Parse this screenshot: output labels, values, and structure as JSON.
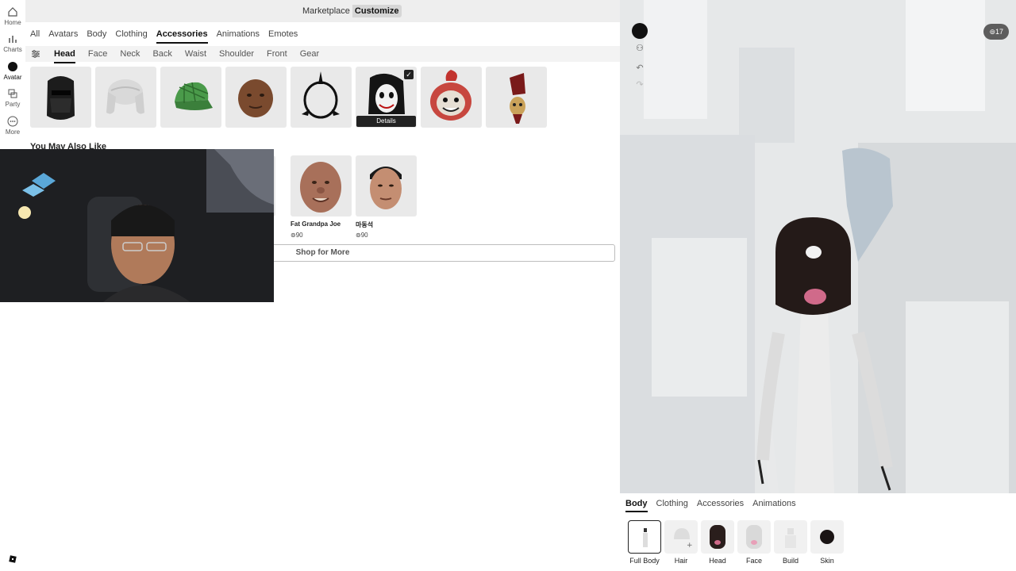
{
  "rail": {
    "items": [
      {
        "label": "Home",
        "icon": "home-icon"
      },
      {
        "label": "Charts",
        "icon": "charts-icon"
      },
      {
        "label": "Avatar",
        "icon": "avatar-icon"
      },
      {
        "label": "Party",
        "icon": "party-icon"
      },
      {
        "label": "More",
        "icon": "more-icon"
      }
    ]
  },
  "topbar": {
    "marketplace": "Marketplace",
    "customize": "Customize"
  },
  "category_tabs": [
    "All",
    "Avatars",
    "Body",
    "Clothing",
    "Accessories",
    "Animations",
    "Emotes"
  ],
  "active_category": "Accessories",
  "sub_tabs": [
    "Head",
    "Face",
    "Neck",
    "Back",
    "Waist",
    "Shoulder",
    "Front",
    "Gear"
  ],
  "active_sub_tab": "Head",
  "inventory": {
    "items": [
      {
        "icon": "black-hood-mask-item"
      },
      {
        "icon": "white-trapper-hat-item"
      },
      {
        "icon": "green-plaid-cap-item"
      },
      {
        "icon": "brown-clay-head-item"
      },
      {
        "icon": "black-spike-ring-item"
      },
      {
        "icon": "white-mask-hair-item",
        "selected": true,
        "details": "Details"
      },
      {
        "icon": "clown-head-item"
      },
      {
        "icon": "red-hat-figure-item"
      }
    ]
  },
  "ymal": {
    "title": "You May Also Like",
    "items": [
      {
        "name": "Fat Grandpa Joe",
        "price": "⊚90"
      },
      {
        "name": "마동석",
        "price": "⊚90"
      }
    ],
    "shop_more": "Shop for More"
  },
  "viewport": {
    "robux": "⊚17"
  },
  "bottom": {
    "tabs": [
      "Body",
      "Clothing",
      "Accessories",
      "Animations"
    ],
    "active_tab": "Body",
    "items": [
      "Full Body",
      "Hair",
      "Head",
      "Face",
      "Build",
      "Skin"
    ]
  },
  "colors": {
    "accent": "#111111",
    "panel": "#eeeeee",
    "scene": "#e7e9ea"
  }
}
